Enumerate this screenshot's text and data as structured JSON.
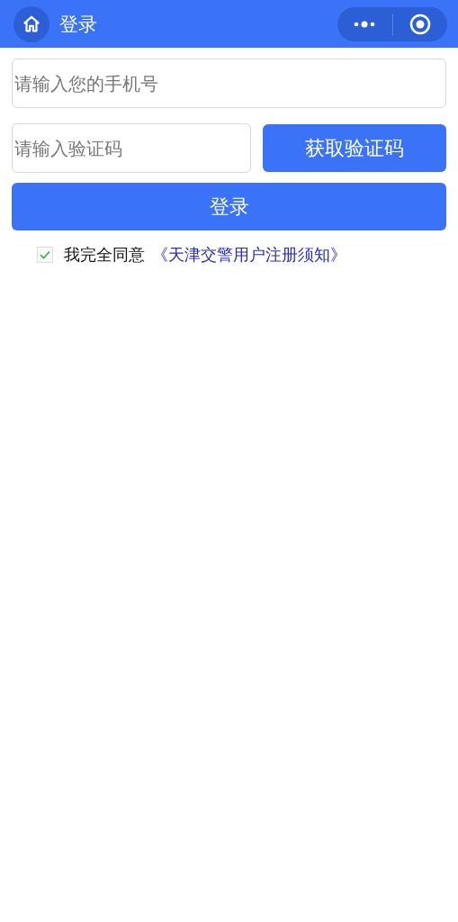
{
  "nav": {
    "title": "登录"
  },
  "phone_field": {
    "placeholder": "请输入您的手机号"
  },
  "code_field": {
    "placeholder": "请输入验证码"
  },
  "get_code_button": "获取验证码",
  "login_button": "登录",
  "agreement": {
    "checked": true,
    "text": "我完全同意",
    "link": "《天津交警用户注册须知》"
  }
}
